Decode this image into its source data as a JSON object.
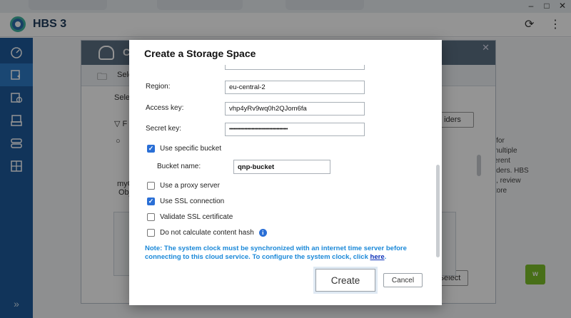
{
  "window": {
    "minimize_icon": "minimize-icon",
    "maximize_icon": "maximize-icon",
    "close_icon": "close-icon"
  },
  "app": {
    "title": "HBS 3",
    "refresh_icon": "refresh-icon",
    "more_icon": "more-vertical-icon"
  },
  "sidebar": {
    "items": [
      {
        "name": "overview",
        "icon": "dashboard-icon"
      },
      {
        "name": "backup",
        "icon": "backup-icon",
        "active": true
      },
      {
        "name": "sync",
        "icon": "sync-icon"
      },
      {
        "name": "restore",
        "icon": "restore-icon"
      },
      {
        "name": "storage",
        "icon": "storage-icon"
      },
      {
        "name": "services",
        "icon": "services-icon"
      }
    ],
    "collapse_label": "»"
  },
  "background": {
    "right_text": [
      "ble for",
      "te multiple",
      "different",
      "roviders. HBS",
      "obs, review",
      "restore"
    ],
    "providers_btn": "iders",
    "select_btn": "Select",
    "left_text": [
      "myC",
      "Obj"
    ],
    "green_btn": "w"
  },
  "wizard": {
    "title_fragment": "C",
    "sub_fragment": "Sele",
    "select_fragment": "Selec",
    "filter_fragment": "F",
    "close_icon": "close-icon"
  },
  "dialog": {
    "title": "Create a Storage Space",
    "region_label": "Region:",
    "region_value": "eu-central-2",
    "access_key_label": "Access key:",
    "access_key_value": "vhp4yRv9wq0h2QJom6fa",
    "secret_key_label": "Secret key:",
    "secret_key_value": "••••••••••••••••••••••••••••••••••••••••••",
    "use_specific_bucket_label": "Use specific bucket",
    "use_specific_bucket_checked": true,
    "bucket_name_label": "Bucket name:",
    "bucket_name_value": "qnp-bucket",
    "use_proxy_label": "Use a proxy server",
    "use_proxy_checked": false,
    "use_ssl_label": "Use SSL connection",
    "use_ssl_checked": true,
    "validate_ssl_label": "Validate SSL certificate",
    "validate_ssl_checked": false,
    "no_content_hash_label": "Do not calculate content hash",
    "no_content_hash_checked": false,
    "info_icon": "info-icon",
    "note_text": "Note: The system clock must be synchronized with an internet time server before connecting to this cloud service. To configure the system clock, click ",
    "note_link": "here",
    "note_end": ".",
    "create_label": "Create",
    "cancel_label": "Cancel"
  },
  "colors": {
    "sidebar_bg": "#1e5b9c",
    "accent_blue": "#2a6fd6",
    "note_blue": "#1a88d8",
    "wizard_header": "#5c7084"
  }
}
